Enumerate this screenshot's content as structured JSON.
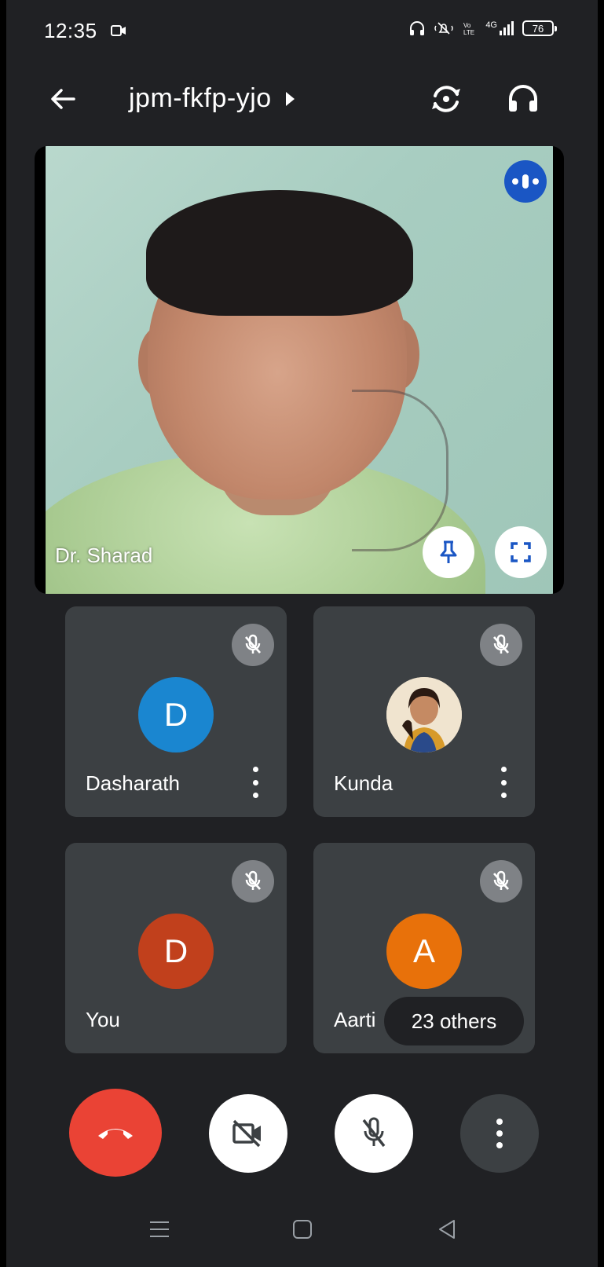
{
  "status_bar": {
    "time": "12:35",
    "network": "4G",
    "battery": "76"
  },
  "header": {
    "meeting_code": "jpm-fkfp-yjo"
  },
  "main_tile": {
    "participant_name": "Dr. Sharad"
  },
  "participants": [
    {
      "name": "Dasharath",
      "avatar_letter": "D",
      "avatar_color": "#1a86d0",
      "muted": true
    },
    {
      "name": "Kunda",
      "avatar_letter": "",
      "avatar_color": "#e8d8c0",
      "muted": true
    },
    {
      "name": "You",
      "avatar_letter": "D",
      "avatar_color": "#c1401c",
      "muted": true
    },
    {
      "name": "Aarti",
      "avatar_letter": "A",
      "avatar_color": "#e8710a",
      "muted": true
    }
  ],
  "others_chip": "23 others",
  "colors": {
    "background": "#202124",
    "tile": "#3c4043",
    "end_call": "#ea4335",
    "speaking": "#1a56c4"
  },
  "icons": {
    "back": "arrow-left-icon",
    "flip_camera": "flip-camera-icon",
    "audio_output": "headphones-icon",
    "pin": "pin-icon",
    "fullscreen": "fullscreen-icon",
    "mic_off": "mic-off-icon",
    "camera_off": "camera-off-icon",
    "end_call": "phone-hangup-icon",
    "more": "more-vert-icon"
  }
}
